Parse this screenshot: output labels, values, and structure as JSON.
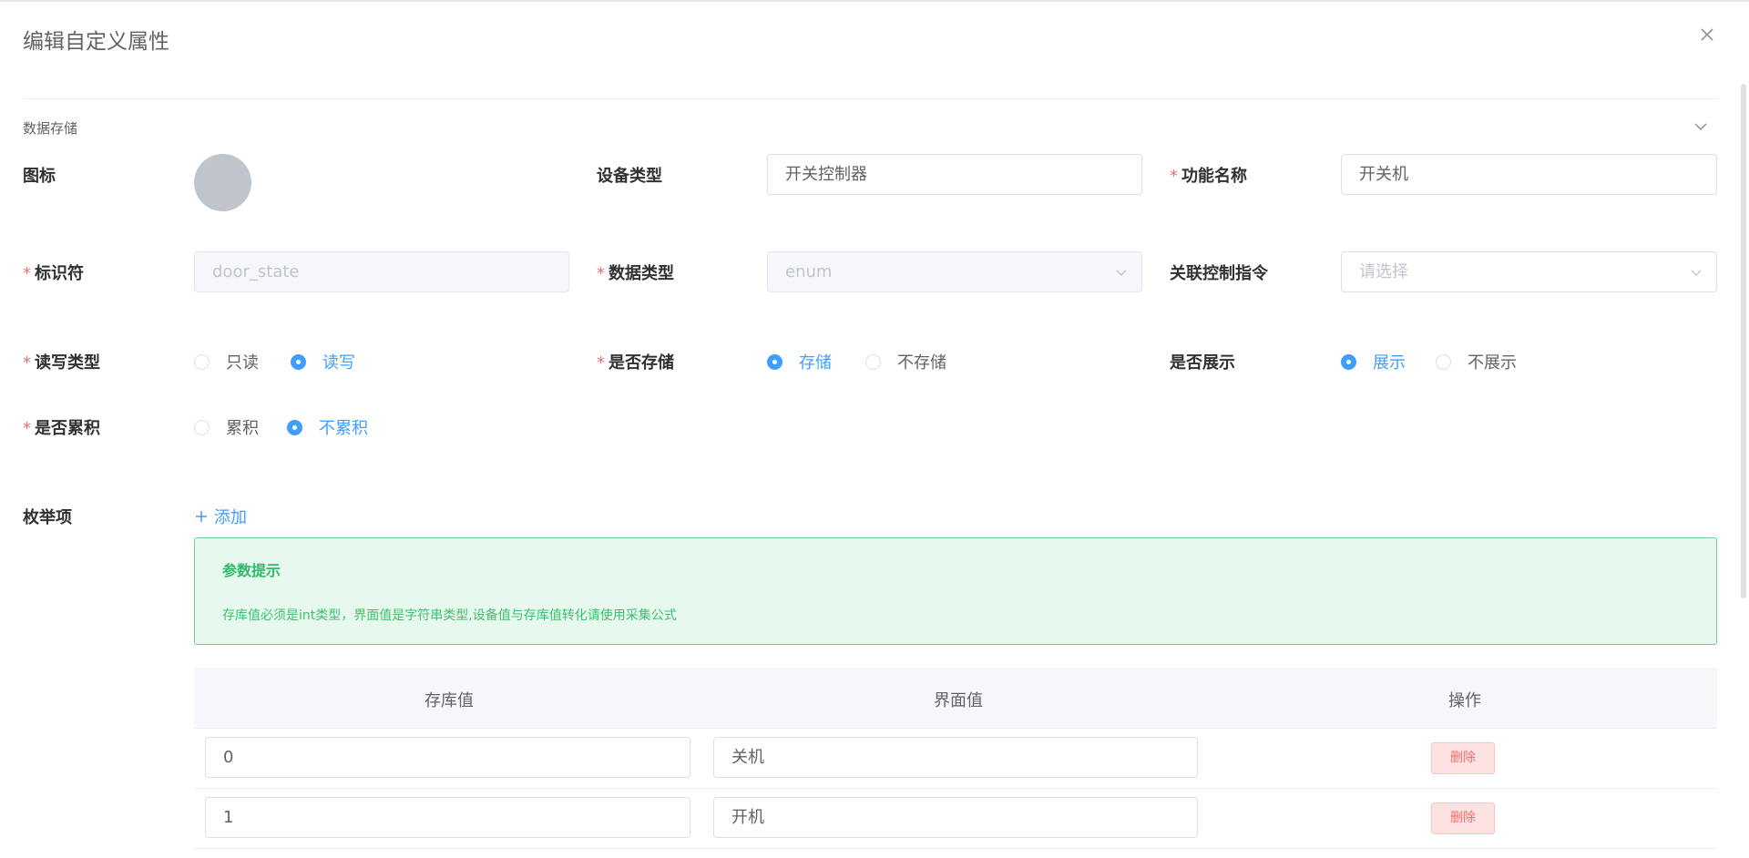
{
  "dialog": {
    "title": "编辑自定义属性",
    "section": "数据存储"
  },
  "form": {
    "icon_label": "图标",
    "device_type": {
      "label": "设备类型",
      "value": "开关控制器"
    },
    "function_name": {
      "required": "*",
      "label": "功能名称",
      "value": "开关机"
    },
    "identifier": {
      "required": "*",
      "label": "标识符",
      "value": "door_state"
    },
    "data_type": {
      "required": "*",
      "label": "数据类型",
      "value": "enum"
    },
    "linked_command": {
      "label": "关联控制指令",
      "placeholder": "请选择"
    },
    "rw_type": {
      "required": "*",
      "label": "读写类型",
      "options": [
        "只读",
        "读写"
      ],
      "selected": "读写"
    },
    "is_stored": {
      "required": "*",
      "label": "是否存储",
      "options": [
        "存储",
        "不存储"
      ],
      "selected": "存储"
    },
    "is_shown": {
      "label": "是否展示",
      "options": [
        "展示",
        "不展示"
      ],
      "selected": "展示"
    },
    "is_accumulated": {
      "required": "*",
      "label": "是否累积",
      "options": [
        "累积",
        "不累积"
      ],
      "selected": "不累积"
    }
  },
  "enum": {
    "label": "枚举项",
    "add_label": "添加",
    "alert": {
      "title": "参数提示",
      "desc": "存库值必须是int类型，界面值是字符串类型,设备值与存库值转化请使用采集公式"
    },
    "columns": [
      "存库值",
      "界面值",
      "操作"
    ],
    "rows": [
      {
        "store": "0",
        "display": "关机",
        "action": "删除"
      },
      {
        "store": "1",
        "display": "开机",
        "action": "删除"
      }
    ]
  },
  "colors": {
    "primary": "#409eff",
    "danger": "#f56c6c",
    "success": "#30b968"
  }
}
